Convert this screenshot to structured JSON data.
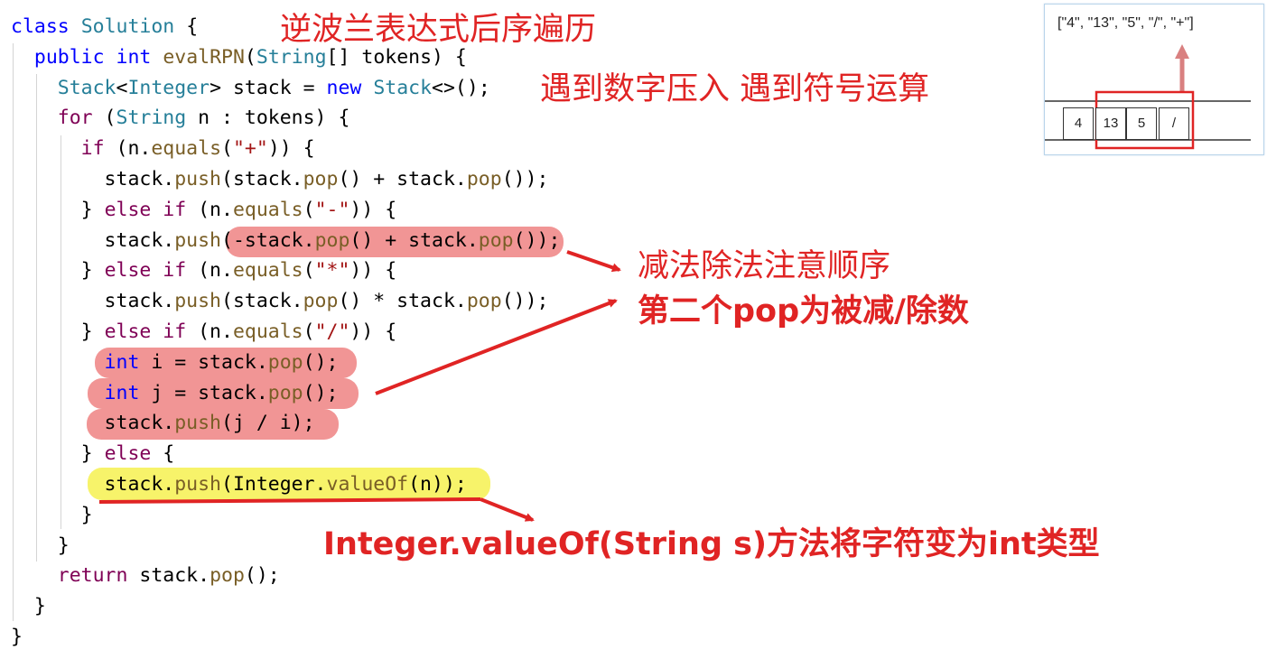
{
  "code": {
    "lines": [
      [
        {
          "t": "class",
          "c": "t-kw"
        },
        {
          "t": " ",
          "c": "t-plain"
        },
        {
          "t": "Solution",
          "c": "t-type"
        },
        {
          "t": " {",
          "c": "t-plain"
        }
      ],
      [
        {
          "t": "  public",
          "c": "t-kw"
        },
        {
          "t": " ",
          "c": "t-plain"
        },
        {
          "t": "int",
          "c": "t-kw"
        },
        {
          "t": " ",
          "c": "t-plain"
        },
        {
          "t": "evalRPN",
          "c": "t-fn"
        },
        {
          "t": "(",
          "c": "t-plain"
        },
        {
          "t": "String",
          "c": "t-type"
        },
        {
          "t": "[] tokens) {",
          "c": "t-plain"
        }
      ],
      [
        {
          "t": "    Stack",
          "c": "t-type"
        },
        {
          "t": "<",
          "c": "t-plain"
        },
        {
          "t": "Integer",
          "c": "t-type"
        },
        {
          "t": "> stack = ",
          "c": "t-plain"
        },
        {
          "t": "new",
          "c": "t-kw"
        },
        {
          "t": " ",
          "c": "t-plain"
        },
        {
          "t": "Stack",
          "c": "t-type"
        },
        {
          "t": "<>();",
          "c": "t-plain"
        }
      ],
      [
        {
          "t": "    for",
          "c": "t-kw2"
        },
        {
          "t": " (",
          "c": "t-plain"
        },
        {
          "t": "String",
          "c": "t-type"
        },
        {
          "t": " n : tokens) {",
          "c": "t-plain"
        }
      ],
      [
        {
          "t": "      if",
          "c": "t-kw2"
        },
        {
          "t": " (n.",
          "c": "t-plain"
        },
        {
          "t": "equals",
          "c": "t-fn"
        },
        {
          "t": "(",
          "c": "t-plain"
        },
        {
          "t": "\"+\"",
          "c": "t-str"
        },
        {
          "t": ")) {",
          "c": "t-plain"
        }
      ],
      [
        {
          "t": "        stack.",
          "c": "t-plain"
        },
        {
          "t": "push",
          "c": "t-fn"
        },
        {
          "t": "(stack.",
          "c": "t-plain"
        },
        {
          "t": "pop",
          "c": "t-fn"
        },
        {
          "t": "() + stack.",
          "c": "t-plain"
        },
        {
          "t": "pop",
          "c": "t-fn"
        },
        {
          "t": "());",
          "c": "t-plain"
        }
      ],
      [
        {
          "t": "      } ",
          "c": "t-plain"
        },
        {
          "t": "else if",
          "c": "t-kw2"
        },
        {
          "t": " (n.",
          "c": "t-plain"
        },
        {
          "t": "equals",
          "c": "t-fn"
        },
        {
          "t": "(",
          "c": "t-plain"
        },
        {
          "t": "\"-\"",
          "c": "t-str"
        },
        {
          "t": ")) {",
          "c": "t-plain"
        }
      ],
      [
        {
          "t": "        stack.",
          "c": "t-plain"
        },
        {
          "t": "push",
          "c": "t-fn"
        },
        {
          "t": "(-stack.",
          "c": "t-plain"
        },
        {
          "t": "pop",
          "c": "t-fn"
        },
        {
          "t": "() + stack.",
          "c": "t-plain"
        },
        {
          "t": "pop",
          "c": "t-fn"
        },
        {
          "t": "());",
          "c": "t-plain"
        }
      ],
      [
        {
          "t": "      } ",
          "c": "t-plain"
        },
        {
          "t": "else if",
          "c": "t-kw2"
        },
        {
          "t": " (n.",
          "c": "t-plain"
        },
        {
          "t": "equals",
          "c": "t-fn"
        },
        {
          "t": "(",
          "c": "t-plain"
        },
        {
          "t": "\"*\"",
          "c": "t-str"
        },
        {
          "t": ")) {",
          "c": "t-plain"
        }
      ],
      [
        {
          "t": "        stack.",
          "c": "t-plain"
        },
        {
          "t": "push",
          "c": "t-fn"
        },
        {
          "t": "(stack.",
          "c": "t-plain"
        },
        {
          "t": "pop",
          "c": "t-fn"
        },
        {
          "t": "() * stack.",
          "c": "t-plain"
        },
        {
          "t": "pop",
          "c": "t-fn"
        },
        {
          "t": "());",
          "c": "t-plain"
        }
      ],
      [
        {
          "t": "      } ",
          "c": "t-plain"
        },
        {
          "t": "else if",
          "c": "t-kw2"
        },
        {
          "t": " (n.",
          "c": "t-plain"
        },
        {
          "t": "equals",
          "c": "t-fn"
        },
        {
          "t": "(",
          "c": "t-plain"
        },
        {
          "t": "\"/\"",
          "c": "t-str"
        },
        {
          "t": ")) {",
          "c": "t-plain"
        }
      ],
      [
        {
          "t": "        int",
          "c": "t-kw"
        },
        {
          "t": " i = stack.",
          "c": "t-plain"
        },
        {
          "t": "pop",
          "c": "t-fn"
        },
        {
          "t": "();",
          "c": "t-plain"
        }
      ],
      [
        {
          "t": "        int",
          "c": "t-kw"
        },
        {
          "t": " j = stack.",
          "c": "t-plain"
        },
        {
          "t": "pop",
          "c": "t-fn"
        },
        {
          "t": "();",
          "c": "t-plain"
        }
      ],
      [
        {
          "t": "        stack.",
          "c": "t-plain"
        },
        {
          "t": "push",
          "c": "t-fn"
        },
        {
          "t": "(j / i);",
          "c": "t-plain"
        }
      ],
      [
        {
          "t": "      } ",
          "c": "t-plain"
        },
        {
          "t": "else",
          "c": "t-kw2"
        },
        {
          "t": " {",
          "c": "t-plain"
        }
      ],
      [
        {
          "t": "        stack.",
          "c": "t-plain"
        },
        {
          "t": "push",
          "c": "t-fn"
        },
        {
          "t": "(Integer.",
          "c": "t-plain"
        },
        {
          "t": "valueOf",
          "c": "t-fn"
        },
        {
          "t": "(n));",
          "c": "t-plain"
        }
      ],
      [
        {
          "t": "      }",
          "c": "t-plain"
        }
      ],
      [
        {
          "t": "    }",
          "c": "t-plain"
        }
      ],
      [
        {
          "t": "    return",
          "c": "t-kw2"
        },
        {
          "t": " stack.",
          "c": "t-plain"
        },
        {
          "t": "pop",
          "c": "t-fn"
        },
        {
          "t": "();",
          "c": "t-plain"
        }
      ],
      [
        {
          "t": "  }",
          "c": "t-plain"
        }
      ],
      [
        {
          "t": "}",
          "c": "t-plain"
        }
      ]
    ]
  },
  "annotations": {
    "title": "逆波兰表达式后序遍历",
    "rule": "遇到数字压入 遇到符号运算",
    "note_order": "减法除法注意顺序",
    "note_second_pop": "第二个pop为被减/除数",
    "note_valueof": "Integer.valueOf(String s)方法将字符变为int类型"
  },
  "diagram": {
    "tokens_label": "[\"4\", \"13\", \"5\", \"/\", \"+\"]",
    "cells": [
      "4",
      "13",
      "5",
      "/"
    ]
  },
  "colors": {
    "annotation_red": "#e02424",
    "highlight_red": "#f08a8a",
    "highlight_yellow": "#f7f36a"
  }
}
